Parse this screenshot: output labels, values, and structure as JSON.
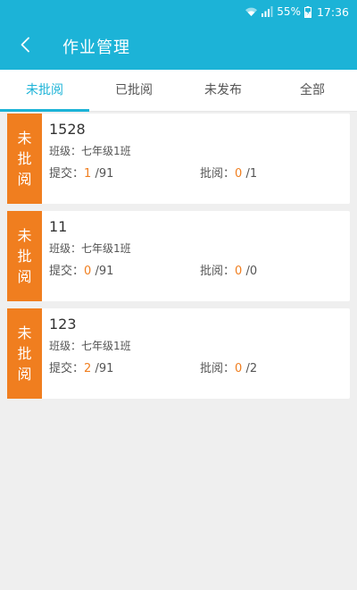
{
  "status": {
    "battery": "55%",
    "time": "17:36",
    "icons": [
      "wifi-icon",
      "signal-icon",
      "battery-charging-icon"
    ]
  },
  "header": {
    "title": "作业管理",
    "back_icon": "chevron-left-icon"
  },
  "tabs": [
    {
      "label": "未批阅",
      "active": true
    },
    {
      "label": "已批阅",
      "active": false
    },
    {
      "label": "未发布",
      "active": false
    },
    {
      "label": "全部",
      "active": false
    }
  ],
  "colors": {
    "accent": "#1cb3d7",
    "badge": "#f07e1f",
    "background": "#efefef"
  },
  "homework": [
    {
      "badge": [
        "未",
        "批",
        "阅"
      ],
      "title": "1528",
      "class_label": "班级：七年级1班",
      "submit_label": "提交：",
      "submit_count": "1",
      "submit_total": "/91",
      "review_label": "批阅：",
      "review_count": "0",
      "review_total": "/1"
    },
    {
      "badge": [
        "未",
        "批",
        "阅"
      ],
      "title": "11",
      "class_label": "班级：七年级1班",
      "submit_label": "提交：",
      "submit_count": "0",
      "submit_total": "/91",
      "review_label": "批阅：",
      "review_count": "0",
      "review_total": "/0"
    },
    {
      "badge": [
        "未",
        "批",
        "阅"
      ],
      "title": "123",
      "class_label": "班级：七年级1班",
      "submit_label": "提交：",
      "submit_count": "2",
      "submit_total": "/91",
      "review_label": "批阅：",
      "review_count": "0",
      "review_total": "/2"
    }
  ]
}
